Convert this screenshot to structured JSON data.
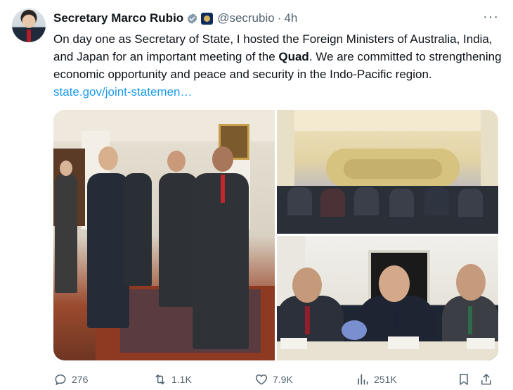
{
  "tweet": {
    "display_name": "Secretary Marco Rubio",
    "handle": "@secrubio",
    "separator": "·",
    "time": "4h",
    "more": "···",
    "text_part1": "On day one as Secretary of State, I hosted the Foreign Ministers of Australia, India, and Japan for an important meeting of the ",
    "text_bold": "Quad",
    "text_part2": ". We are committed to strengthening economic opportunity and peace and security in the Indo-Pacific region. ",
    "link": "state.gov/joint-statemen…"
  },
  "actions": {
    "replies": "276",
    "reposts": "1.1K",
    "likes": "7.9K",
    "views": "251K"
  },
  "colors": {
    "accent": "#1d9bf0",
    "muted": "#536471",
    "text": "#0f1419"
  }
}
